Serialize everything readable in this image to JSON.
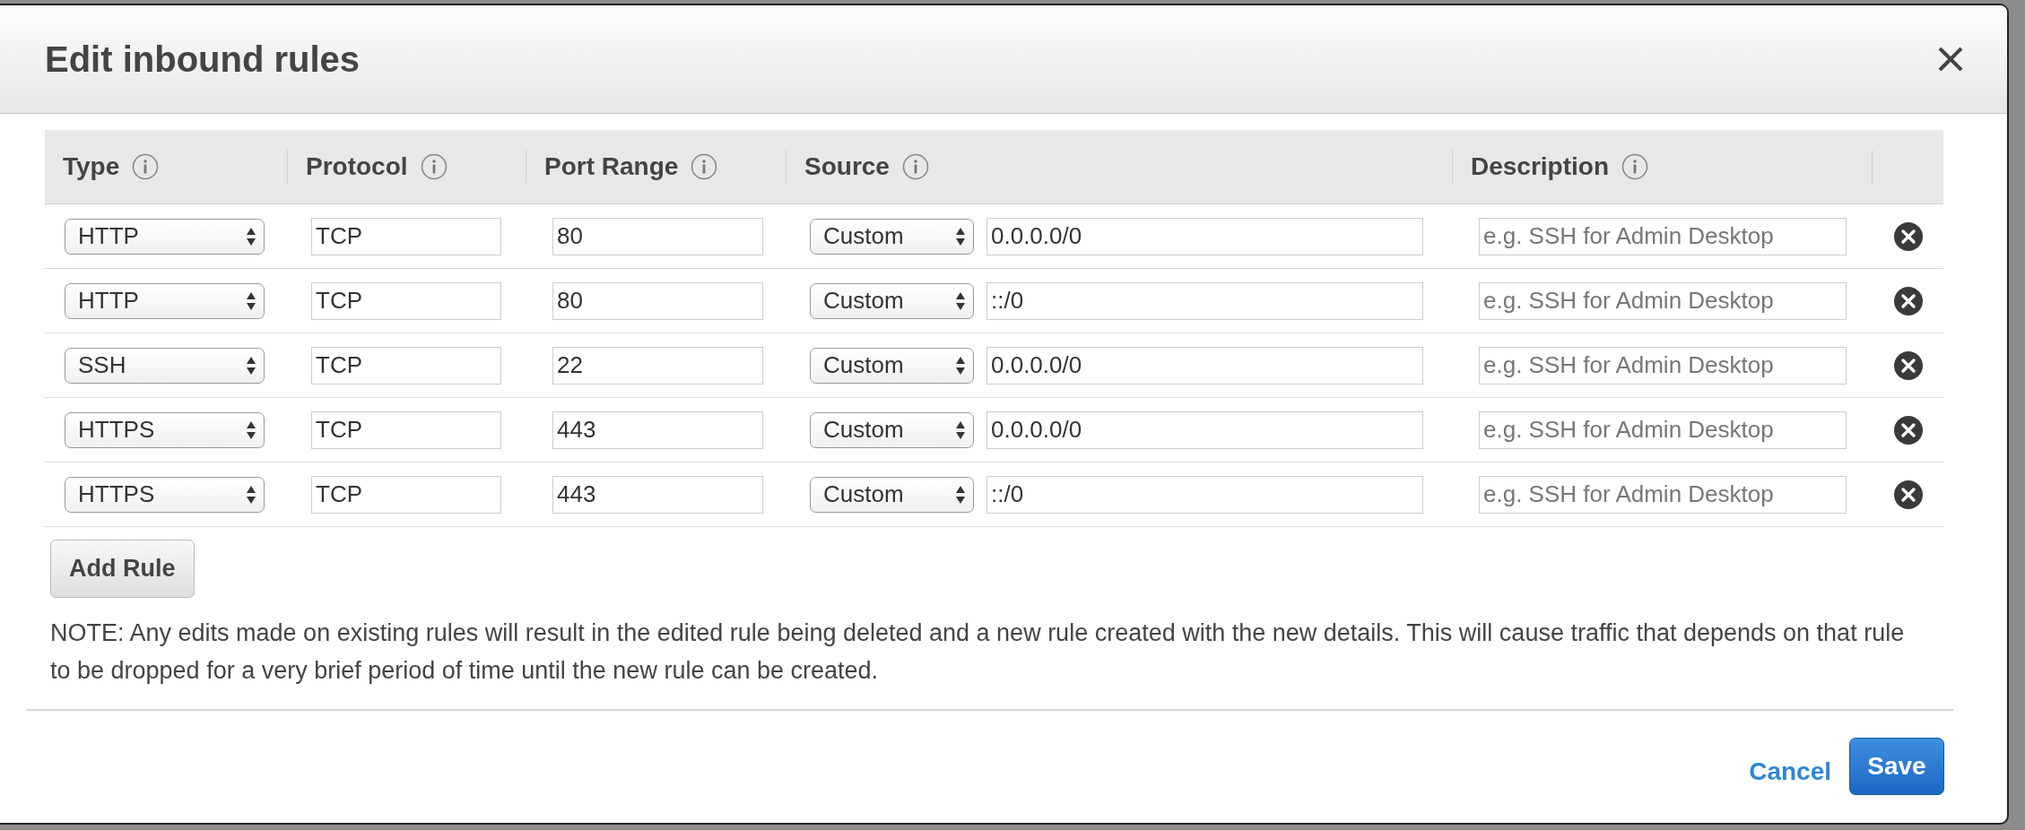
{
  "dialog": {
    "title": "Edit inbound rules"
  },
  "table": {
    "columns": [
      "Type",
      "Protocol",
      "Port Range",
      "Source",
      "Description"
    ],
    "rows": [
      {
        "type": "HTTP",
        "protocol": "TCP",
        "port_range": "80",
        "source_mode": "Custom",
        "source": "0.0.0.0/0",
        "description": {
          "placeholder": "e.g. SSH for Admin Desktop"
        }
      },
      {
        "type": "HTTP",
        "protocol": "TCP",
        "port_range": "80",
        "source_mode": "Custom",
        "source": "::/0",
        "description": {
          "placeholder": "e.g. SSH for Admin Desktop"
        }
      },
      {
        "type": "SSH",
        "protocol": "TCP",
        "port_range": "22",
        "source_mode": "Custom",
        "source": "0.0.0.0/0",
        "description": {
          "placeholder": "e.g. SSH for Admin Desktop"
        }
      },
      {
        "type": "HTTPS",
        "protocol": "TCP",
        "port_range": "443",
        "source_mode": "Custom",
        "source": "0.0.0.0/0",
        "description": {
          "placeholder": "e.g. SSH for Admin Desktop"
        }
      },
      {
        "type": "HTTPS",
        "protocol": "TCP",
        "port_range": "443",
        "source_mode": "Custom",
        "source": "::/0",
        "description": {
          "placeholder": "e.g. SSH for Admin Desktop"
        }
      }
    ]
  },
  "add_rule_button": "Add Rule",
  "note": "NOTE: Any edits made on existing rules will result in the edited rule being deleted and a new rule created with the new details. This will cause traffic that depends on that rule to be dropped for a very brief period of time until the new rule can be created.",
  "footer": {
    "cancel": "Cancel",
    "save": "Save"
  }
}
